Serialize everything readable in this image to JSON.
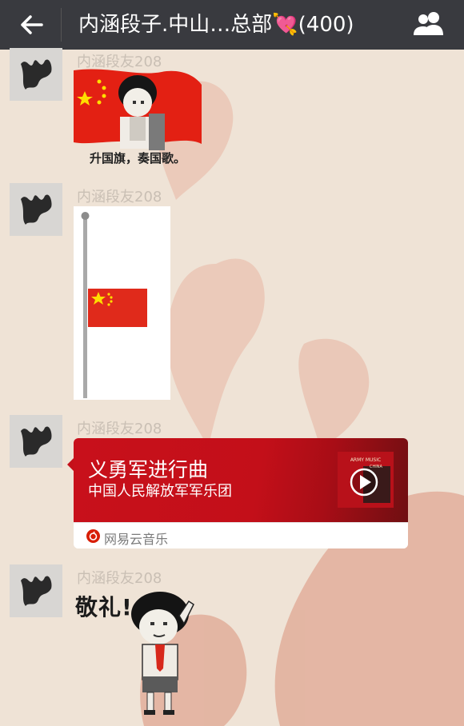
{
  "header": {
    "title": "内涵段子.中山…总部💘(400)",
    "back_icon": "arrow-left-icon",
    "group_icon": "group-members-icon"
  },
  "messages": [
    {
      "sender": "内涵段友208",
      "type": "sticker",
      "caption": "升国旗，奏国歌。"
    },
    {
      "sender": "内涵段友208",
      "type": "image"
    },
    {
      "sender": "内涵段友208",
      "type": "music",
      "song": "义勇军进行曲",
      "artist": "中国人民解放军军乐团",
      "source": "网易云音乐",
      "album_text_1": "ARMY MUSIC",
      "album_text_2": "CHINA"
    },
    {
      "sender": "内涵段友208",
      "type": "sticker",
      "caption": "敬礼!"
    }
  ],
  "colors": {
    "topbar": "#393a3f",
    "music_card": "#c8101b",
    "flag_red": "#de2910",
    "flag_yellow": "#ffde00"
  }
}
